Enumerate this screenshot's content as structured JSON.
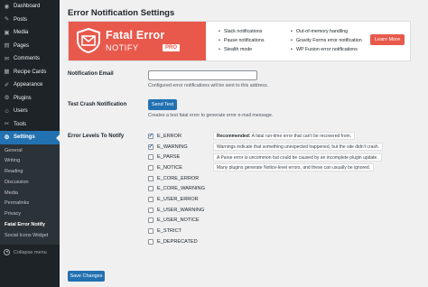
{
  "sidebar": {
    "items": [
      {
        "label": "Dashboard",
        "icon": "dashboard-icon",
        "glyph": "◉"
      },
      {
        "label": "Posts",
        "icon": "pin-icon",
        "glyph": "✎"
      },
      {
        "label": "Media",
        "icon": "media-icon",
        "glyph": "▣"
      },
      {
        "label": "Pages",
        "icon": "page-icon",
        "glyph": "▤"
      },
      {
        "label": "Comments",
        "icon": "comment-icon",
        "glyph": "✉"
      },
      {
        "label": "Recipe Cards",
        "icon": "recipe-icon",
        "glyph": "▦"
      },
      {
        "label": "Appearance",
        "icon": "brush-icon",
        "glyph": "✐"
      },
      {
        "label": "Plugins",
        "icon": "plugin-icon",
        "glyph": "⚙"
      },
      {
        "label": "Users",
        "icon": "user-icon",
        "glyph": "☺"
      },
      {
        "label": "Tools",
        "icon": "wrench-icon",
        "glyph": "✂"
      },
      {
        "label": "Settings",
        "icon": "settings-icon",
        "glyph": "⚙"
      }
    ],
    "submenu": [
      "General",
      "Writing",
      "Reading",
      "Discussion",
      "Media",
      "Permalinks",
      "Privacy",
      "Fatal Error Notify",
      "Social Icons Widget"
    ],
    "collapse_label": "Collapse menu"
  },
  "page": {
    "title": "Error Notification Settings"
  },
  "banner": {
    "brand_line1": "Fatal Error",
    "brand_line2": "NOTIFY",
    "badge": "PRO",
    "features_col1": [
      "Slack notifications",
      "Pause notifications",
      "Stealth mode"
    ],
    "features_col2": [
      "Out-of-memory handling",
      "Gravity Forms error notification",
      "WP Fusion error notifications"
    ],
    "learn_more": "Learn More",
    "accent_color": "#e8594c"
  },
  "form": {
    "email_label": "Notification Email",
    "email_value": "",
    "email_desc": "Configured error notifications will be sent to this address.",
    "test_label": "Test Crash Notification",
    "test_button": "Send Test",
    "test_desc": "Creates a test fatal error to generate error e-mail message.",
    "levels_label": "Error Levels To Notify",
    "levels": [
      {
        "name": "E_ERROR",
        "checked": true,
        "note_strong": "Recommended:",
        "note": " A fatal run-time error that can't be recovered from."
      },
      {
        "name": "E_WARNING",
        "checked": true,
        "note_strong": "",
        "note": "Warnings indicate that something unexpected happened, but the site didn't crash."
      },
      {
        "name": "E_PARSE",
        "checked": false,
        "note_strong": "",
        "note": "A Parse error is uncommon but could be caused by an incomplete plugin update."
      },
      {
        "name": "E_NOTICE",
        "checked": false,
        "note_strong": "",
        "note": "Many plugins generate Notice-level errors, and these can usually be ignored."
      },
      {
        "name": "E_CORE_ERROR",
        "checked": false,
        "note_strong": "",
        "note": ""
      },
      {
        "name": "E_CORE_WARNING",
        "checked": false,
        "note_strong": "",
        "note": ""
      },
      {
        "name": "E_USER_ERROR",
        "checked": false,
        "note_strong": "",
        "note": ""
      },
      {
        "name": "E_USER_WARNING",
        "checked": false,
        "note_strong": "",
        "note": ""
      },
      {
        "name": "E_USER_NOTICE",
        "checked": false,
        "note_strong": "",
        "note": ""
      },
      {
        "name": "E_STRICT",
        "checked": false,
        "note_strong": "",
        "note": ""
      },
      {
        "name": "E_DEPRECATED",
        "checked": false,
        "note_strong": "",
        "note": ""
      }
    ],
    "save_button": "Save Changes"
  },
  "colors": {
    "sidebar_bg": "#1d2327",
    "active": "#2271b1",
    "brand": "#e8594c"
  }
}
